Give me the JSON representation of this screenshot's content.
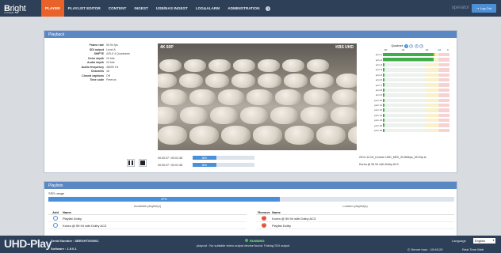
{
  "brand": {
    "logo_bold": "B",
    "logo_rest": "right",
    "logo_sub": "SYSTEMS"
  },
  "nav": {
    "items": [
      "PLAYER",
      "PLAYLIST EDITOR",
      "CONTENT",
      "INGEST",
      "USB/NAS INGEST",
      "LOG&ALARM",
      "ADMINISTRATION"
    ],
    "active": "PLAYER",
    "info_icon": "info-icon"
  },
  "user": {
    "name": "operator",
    "logout_label": "Log Out"
  },
  "playback": {
    "title": "Playback",
    "properties": [
      {
        "key": "Frame rate",
        "value": "59.94 fps"
      },
      {
        "key": "SDI output",
        "value": "Level A"
      },
      {
        "key": "SMPTE",
        "value": "425-5 4 Quadrants"
      },
      {
        "key": "Color depth",
        "value": "10 bits"
      },
      {
        "key": "Audio depth",
        "value": "24 bits"
      },
      {
        "key": "Audio frequency",
        "value": "48000 Hz"
      },
      {
        "key": "Channels",
        "value": "16"
      },
      {
        "key": "Closed captions",
        "value": "Off"
      },
      {
        "key": "Time code",
        "value": "Freerun"
      }
    ],
    "video_overlay_left": "4K 60P",
    "video_overlay_right": "KBS UHD",
    "progress": [
      {
        "time": "00:00:37 / 00:01:38",
        "percent": 38,
        "label": "38%"
      },
      {
        "time": "00:00:37 / 00:01:38",
        "percent": 38,
        "label": "38%"
      }
    ],
    "file_name": "2014-12-04_Korean UHD_KBS_33.8Mbps_59.94p.ts",
    "file_playlist": "Korea @ 59.94 with Dolby AC3",
    "audio": {
      "quadrant_label": "Quadrant",
      "quadrants": [
        "1",
        "2",
        "3",
        "4"
      ],
      "active_quadrant": "1",
      "scale": [
        "-60",
        "-44",
        "-20",
        "-10",
        "0"
      ],
      "channels": [
        {
          "label": "pcm  1",
          "level": 0.78
        },
        {
          "label": "pcm  2",
          "level": 0.76
        },
        {
          "label": "pcm  3",
          "level": 0.02
        },
        {
          "label": "pcm  4",
          "level": 0.02
        },
        {
          "label": "pcm  5",
          "level": 0.02
        },
        {
          "label": "pcm  6",
          "level": 0.02
        },
        {
          "label": "pcm  7",
          "level": 0.02
        },
        {
          "label": "pcm  8",
          "level": 0.02
        },
        {
          "label": "pcm  9",
          "level": 0.02
        },
        {
          "label": "pcm 10",
          "level": 0.02
        },
        {
          "label": "pcm 11",
          "level": 0.02
        },
        {
          "label": "pcm 12",
          "level": 0.02
        },
        {
          "label": "pcm 13",
          "level": 0.02
        },
        {
          "label": "pcm 14",
          "level": 0.02
        },
        {
          "label": "pcm 15",
          "level": 0.02
        },
        {
          "label": "pcm 16",
          "level": 0.02
        }
      ]
    }
  },
  "playlists": {
    "title": "Playlists",
    "usage_label": "SSD usage",
    "usage_percent": 57,
    "usage_text": "57%",
    "available_title": "Available playlist(s)",
    "loaded_title": "Loaded playlist(s)",
    "available_head": {
      "action": "Add",
      "name": "Name"
    },
    "loaded_head": {
      "action": "Remove",
      "name": "Name"
    },
    "available": [
      "Playlist Dolby",
      "Korea @ 59.94 with Dolby AC3"
    ],
    "loaded": [
      "Korea @ 59.94 with Dolby AC3",
      "Playlist Dolby"
    ]
  },
  "footer": {
    "product": "UHD-Play",
    "serial": "Serial Number : 8BRGHT000001",
    "software": "Software : 1.9.0.1",
    "status": "RUNNING",
    "playout_message": "playout : No suitable video output device found. Faking SDI output",
    "language_label": "Language",
    "language_value": "English",
    "server_time": "Server hour : 15:45:29",
    "realtime": "Real Time Web"
  },
  "colors": {
    "topbar": "#2e3f58",
    "active_nav": "#e8622a",
    "panel_header": "#5b87c2",
    "progress": "#4a90d9"
  }
}
